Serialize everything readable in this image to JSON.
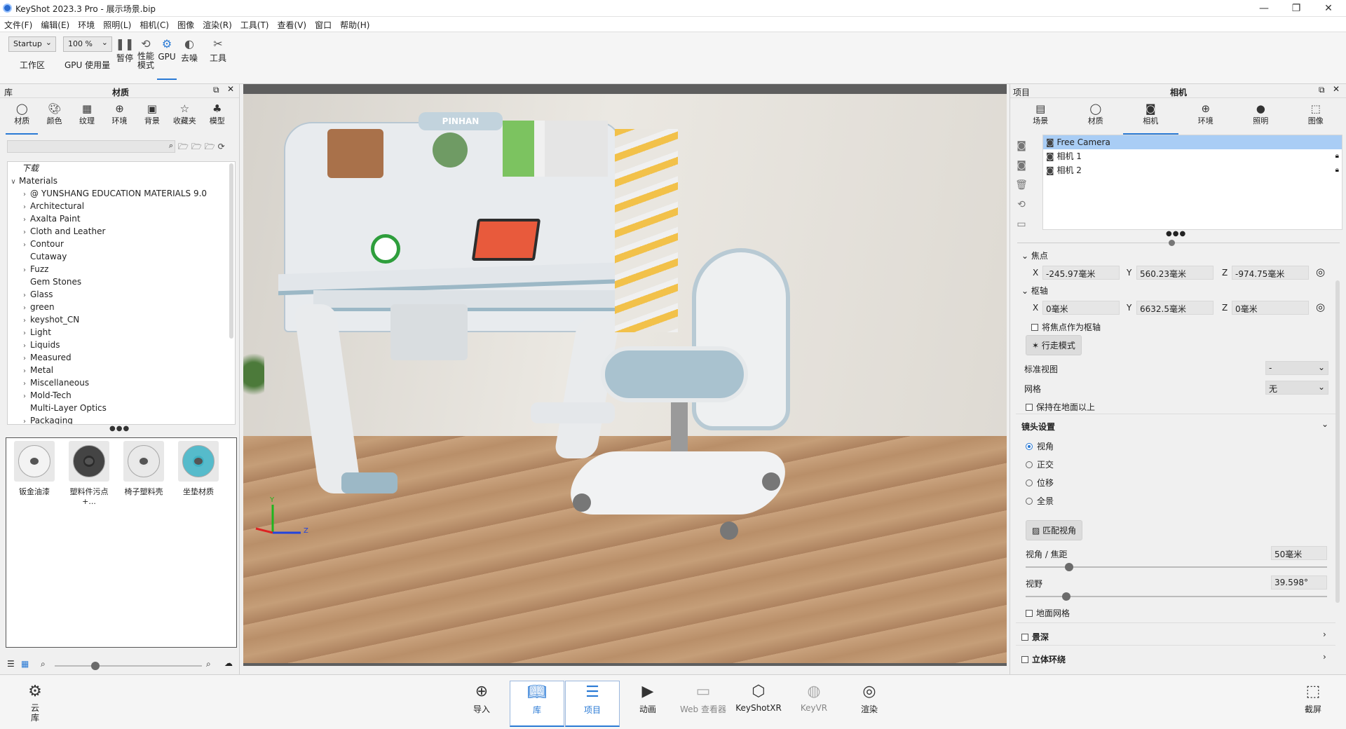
{
  "window": {
    "app_name": "KeyShot 2023.3 Pro",
    "title": "KeyShot 2023.3 Pro  - 展示场景.bip",
    "controls": [
      "—",
      "❐",
      "✕"
    ]
  },
  "menu": [
    "文件(F)",
    "编辑(E)",
    "环境",
    "照明(L)",
    "相机(C)",
    "图像",
    "渲染(R)",
    "工具(T)",
    "查看(V)",
    "窗口",
    "帮助(H)"
  ],
  "toolbar": {
    "workspace_value": "Startup",
    "workspace_label": "工作区",
    "zoom_value": "100 %",
    "gpu_usage_label": "GPU 使用量",
    "pause_label": "暂停",
    "perf_label_1": "性能",
    "perf_label_2": "模式",
    "gpu_label": "GPU",
    "denoise_label": "去噪",
    "tools_label": "工具"
  },
  "library": {
    "header": "库",
    "title": "材质",
    "tabs": [
      {
        "label": "材质",
        "icon": "material-icon"
      },
      {
        "label": "颜色",
        "icon": "palette-icon"
      },
      {
        "label": "纹理",
        "icon": "texture-icon"
      },
      {
        "label": "环境",
        "icon": "globe-icon"
      },
      {
        "label": "背景",
        "icon": "image-icon"
      },
      {
        "label": "收藏夹",
        "icon": "star-icon"
      },
      {
        "label": "模型",
        "icon": "model-icon"
      }
    ],
    "tree_header": "下载",
    "tree_root": "Materials",
    "tree": [
      {
        "label": "@ YUNSHANG EDUCATION MATERIALS 9.0",
        "chev": ">"
      },
      {
        "label": "Architectural",
        "chev": ">"
      },
      {
        "label": "Axalta Paint",
        "chev": ">"
      },
      {
        "label": "Cloth and Leather",
        "chev": ">"
      },
      {
        "label": "Contour",
        "chev": ">"
      },
      {
        "label": "Cutaway",
        "chev": ""
      },
      {
        "label": "Fuzz",
        "chev": ">"
      },
      {
        "label": "Gem Stones",
        "chev": ""
      },
      {
        "label": "Glass",
        "chev": ">"
      },
      {
        "label": "green",
        "chev": ">"
      },
      {
        "label": "keyshot_CN",
        "chev": ">"
      },
      {
        "label": "Light",
        "chev": ">"
      },
      {
        "label": "Liquids",
        "chev": ">"
      },
      {
        "label": "Measured",
        "chev": ">"
      },
      {
        "label": "Metal",
        "chev": ">"
      },
      {
        "label": "Miscellaneous",
        "chev": ">"
      },
      {
        "label": "Mold-Tech",
        "chev": ">"
      },
      {
        "label": "Multi-Layer Optics",
        "chev": ""
      },
      {
        "label": "Packaging",
        "chev": ">"
      }
    ],
    "materials": [
      {
        "label": "钣金油漆",
        "color": "#f2f2f2"
      },
      {
        "label": "塑料件污点+...",
        "color": "#2b2b2b"
      },
      {
        "label": "椅子塑料壳",
        "color": "#e6e6e6"
      },
      {
        "label": "坐垫材质",
        "color": "#3fb2c4"
      }
    ]
  },
  "viewport": {
    "axis_y": "Y",
    "axis_z": "Z"
  },
  "project": {
    "header": "项目",
    "title": "相机",
    "tabs": [
      {
        "label": "场景",
        "icon": "scene-icon"
      },
      {
        "label": "材质",
        "icon": "material-icon"
      },
      {
        "label": "相机",
        "icon": "camera-icon"
      },
      {
        "label": "环境",
        "icon": "globe-icon"
      },
      {
        "label": "照明",
        "icon": "bulb-icon"
      },
      {
        "label": "图像",
        "icon": "crop-icon"
      }
    ],
    "cameras": [
      {
        "label": "Free Camera",
        "locked": false
      },
      {
        "label": "相机 1",
        "locked": true
      },
      {
        "label": "相机 2",
        "locked": true
      }
    ],
    "focus_label": "焦点",
    "focus": {
      "x_label": "X",
      "x": "-245.97毫米",
      "y_label": "Y",
      "y": "560.23毫米",
      "z_label": "Z",
      "z": "-974.75毫米"
    },
    "pivot_label": "枢轴",
    "pivot": {
      "x_label": "X",
      "x": "0毫米",
      "y_label": "Y",
      "y": "6632.5毫米",
      "z_label": "Z",
      "z": "0毫米"
    },
    "use_focus_as_pivot": "将焦点作为枢轴",
    "walk_mode": "行走模式",
    "standard_view_label": "标准视图",
    "standard_view_value": "-",
    "grid_label": "网格",
    "grid_value": "无",
    "keep_above_ground": "保持在地面以上",
    "lens_settings": "镜头设置",
    "lens_options": [
      "视角",
      "正交",
      "位移",
      "全景"
    ],
    "lens_selected": 0,
    "match_view": "匹配视角",
    "fov_focal_label": "视角 / 焦距",
    "fov_focal_value": "50毫米",
    "fov_focal_level": 0.13,
    "field_of_view_label": "视野",
    "field_of_view_value": "39.598°",
    "field_of_view_level": 0.12,
    "ground_grid": "地面网格",
    "depth_of_field": "景深",
    "stereo": "立体环绕"
  },
  "bottom": {
    "cloud_label_1": "云",
    "cloud_label_2": "库",
    "items": [
      {
        "label": "导入",
        "icon": "import-icon"
      },
      {
        "label": "库",
        "icon": "book-icon"
      },
      {
        "label": "项目",
        "icon": "list-icon"
      },
      {
        "label": "动画",
        "icon": "play-icon"
      },
      {
        "label": "Web 查看器",
        "icon": "web-icon"
      },
      {
        "label": "KeyShotXR",
        "icon": "cube-icon"
      },
      {
        "label": "KeyVR",
        "icon": "vr-icon"
      },
      {
        "label": "渲染",
        "icon": "render-icon"
      }
    ],
    "screenshot_label": "截屏"
  }
}
